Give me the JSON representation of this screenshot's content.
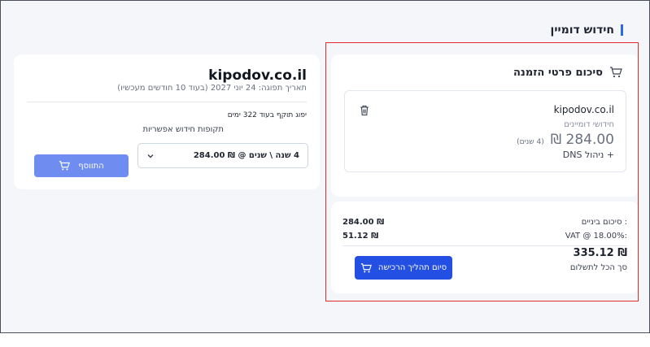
{
  "section": {
    "title": "חידוש דומיין"
  },
  "summary": {
    "title": "סיכום פרטי הזמנה",
    "item": {
      "domain": "kipodov.co.il",
      "type": "חידושי דומיינים",
      "price": "284.00 ₪",
      "years": "(4 שנים)",
      "addon": "+ ניהול DNS"
    }
  },
  "totals": {
    "subtotal_label": "סיכום ביניים :",
    "subtotal_value": "284.00 ₪",
    "vat_label": "VAT @ 18.00%:",
    "vat_value": "51.12 ₪",
    "total_value": "335.12 ₪",
    "total_label": "סך הכל לתשלום",
    "checkout_label": "סיום תהליך הרכישה"
  },
  "domain_card": {
    "domain": "kipodov.co.il",
    "expiry": "תאריך תפוגה: 24 יוני 2027 (בעוד 10 חודשים מעכשיו)",
    "expire_note": "יפוג תוקף בעוד 322 ימים",
    "period_label": "תקופות חידוש אפשריות",
    "period_selected": "4 שנה \\ שנים @ ₪ 284.00",
    "add_label": "התווסף"
  },
  "colors": {
    "accent": "#2a6ae8",
    "checkout_button": "#2350e3",
    "add_button": "#6f8df0",
    "highlight": "#e02b2b"
  },
  "icons": {
    "cart": "cart-icon",
    "trash": "trash-icon",
    "chevron": "chevron-down-icon"
  }
}
